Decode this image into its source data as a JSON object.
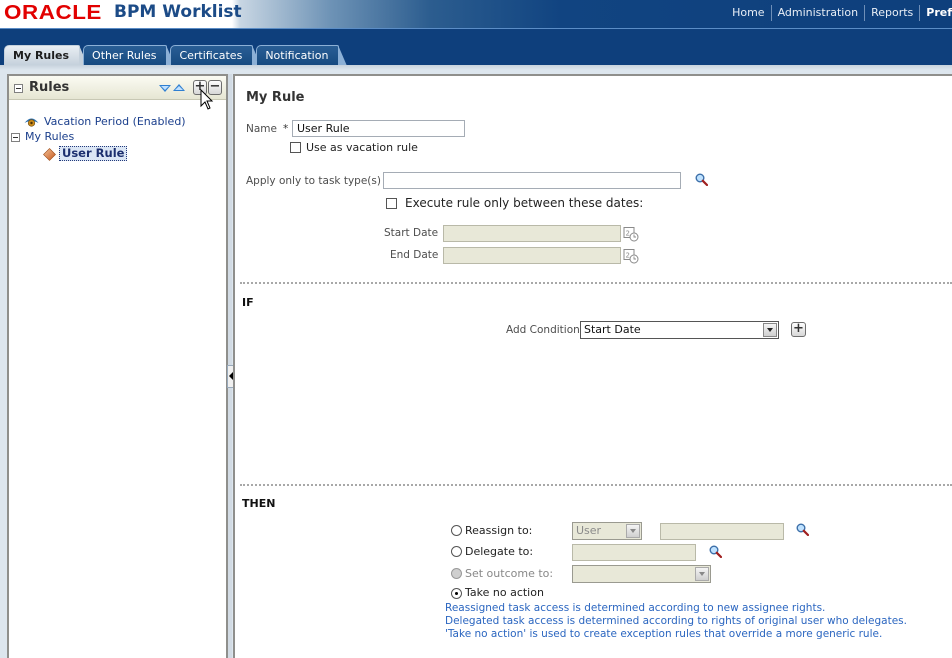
{
  "header": {
    "brand": "ORACLE",
    "app_title": "BPM Worklist",
    "nav": [
      "Home",
      "Administration",
      "Reports",
      "Pref"
    ]
  },
  "tabs": [
    {
      "label": "My Rules",
      "active": true
    },
    {
      "label": "Other Rules",
      "active": false
    },
    {
      "label": "Certificates",
      "active": false
    },
    {
      "label": "Notification",
      "active": false
    }
  ],
  "rules_panel": {
    "title": "Rules",
    "tree": {
      "vacation": "Vacation Period (Enabled)",
      "my_rules": "My Rules",
      "user_rule": "User Rule"
    },
    "buttons": {
      "add": "+",
      "remove": "−"
    }
  },
  "rule_form": {
    "title": "My Rule",
    "name_label": "Name",
    "required_mark": "*",
    "name_value": "User Rule",
    "vacation_checkbox_label": "Use as vacation rule",
    "vacation_checked": false,
    "task_type_label": "Apply only to task type(s)",
    "task_type_value": "",
    "dates_checkbox_label": "Execute rule only between these dates:",
    "dates_checked": false,
    "start_date_label": "Start Date",
    "start_date_value": "",
    "end_date_label": "End Date",
    "end_date_value": ""
  },
  "if_section": {
    "title": "IF",
    "add_condition_label": "Add Condition",
    "add_condition_value": "Start Date",
    "add_button": "+"
  },
  "then_section": {
    "title": "THEN",
    "options": {
      "reassign": {
        "label": "Reassign to:",
        "type_value": "User",
        "value": ""
      },
      "delegate": {
        "label": "Delegate to:",
        "value": ""
      },
      "outcome": {
        "label": "Set outcome to:",
        "value": ""
      },
      "no_action": {
        "label": "Take no action"
      }
    },
    "selected": "no_action",
    "notes": [
      "Reassigned task access is determined according to new assignee rights.",
      "Delegated task access is determined according to rights of original user who delegates.",
      "'Take no action' is used to create exception rules that override a more generic rule."
    ]
  },
  "colors": {
    "header_navy": "#0e3f7c",
    "oracle_red": "#e20000",
    "link_blue": "#1b3f8c",
    "note_blue": "#2b66c0"
  }
}
